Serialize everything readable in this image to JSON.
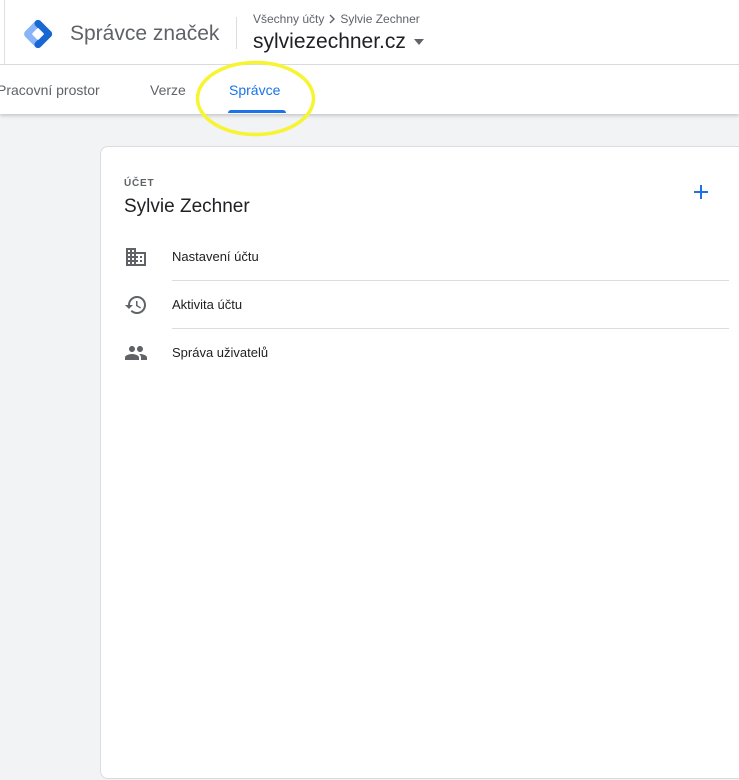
{
  "header": {
    "product_name": "Správce značek",
    "breadcrumb": {
      "root": "Všechny účty",
      "account": "Sylvie Zechner"
    },
    "container_name": "sylviezechner.cz"
  },
  "tabs": [
    {
      "label": "Pracovní prostor",
      "active": false
    },
    {
      "label": "Verze",
      "active": false
    },
    {
      "label": "Správce",
      "active": true
    }
  ],
  "account_card": {
    "eyebrow": "ÚČET",
    "title": "Sylvie Zechner",
    "items": [
      {
        "label": "Nastavení účtu",
        "icon": "building-icon"
      },
      {
        "label": "Aktivita účtu",
        "icon": "history-icon"
      },
      {
        "label": "Správa uživatelů",
        "icon": "people-icon"
      }
    ]
  },
  "colors": {
    "accent": "#1a73e8",
    "highlight": "#f7f431",
    "logo_dark": "#1967d2",
    "logo_light": "#8ab4f8",
    "icon_gray": "#5f6368"
  }
}
